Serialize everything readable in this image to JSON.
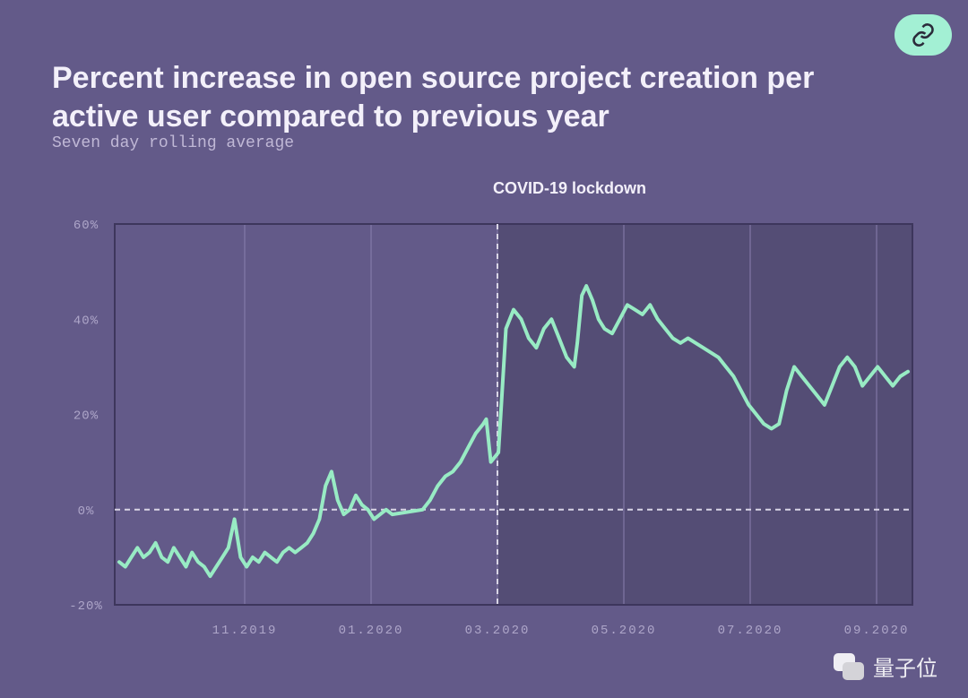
{
  "title": "Percent increase in open source project creation per active user compared to previous year",
  "subtitle": "Seven day rolling average",
  "annotation": "COVID-19 lockdown",
  "watermark": "量子位",
  "chart_data": {
    "type": "line",
    "xlabel": "",
    "ylabel": "",
    "ylim": [
      -20,
      60
    ],
    "y_ticks": [
      -20,
      0,
      20,
      40,
      60
    ],
    "y_tick_labels": [
      "-20%",
      "0%",
      "20%",
      "40%",
      "60%"
    ],
    "x_tick_labels": [
      "11.2019",
      "01.2020",
      "03.2020",
      "05.2020",
      "07.2020",
      "09.2020"
    ],
    "annotation_x": "03.2020",
    "shaded_from_x": "03.2020",
    "series": [
      {
        "name": "percent_increase",
        "x_approx_month_fraction": [
          0.0,
          0.04,
          0.08,
          0.12,
          0.16,
          0.2,
          0.24,
          0.28,
          0.32,
          0.36,
          0.4,
          0.44,
          0.48,
          0.52,
          0.56,
          0.6,
          0.64,
          0.68,
          0.72,
          0.76,
          0.8,
          0.84,
          0.88,
          0.92,
          0.96,
          1.0,
          1.04,
          1.08,
          1.12,
          1.16,
          1.2,
          1.24,
          1.28,
          1.32,
          1.36,
          1.4,
          1.44,
          1.48,
          1.52,
          1.56,
          1.6,
          1.64,
          1.68,
          1.72,
          1.76,
          1.8,
          2.0,
          2.05,
          2.1,
          2.15,
          2.2,
          2.25,
          2.3,
          2.35,
          2.4,
          2.42,
          2.45,
          2.5,
          2.55,
          2.6,
          2.65,
          2.7,
          2.75,
          2.8,
          2.85,
          2.9,
          2.95,
          3.0,
          3.02,
          3.05,
          3.08,
          3.12,
          3.16,
          3.2,
          3.25,
          3.3,
          3.35,
          3.4,
          3.45,
          3.5,
          3.55,
          3.6,
          3.65,
          3.7,
          3.75,
          3.8,
          3.85,
          3.9,
          3.95,
          4.0,
          4.05,
          4.1,
          4.15,
          4.2,
          4.25,
          4.3,
          4.35,
          4.4,
          4.45,
          4.5,
          4.55,
          4.6,
          4.65,
          4.7,
          4.75,
          4.8,
          4.85,
          4.9,
          4.95,
          5.0,
          5.05,
          5.1,
          5.15,
          5.2
        ],
        "values": [
          -11,
          -12,
          -10,
          -8,
          -10,
          -9,
          -7,
          -10,
          -11,
          -8,
          -10,
          -12,
          -9,
          -11,
          -12,
          -14,
          -12,
          -10,
          -8,
          -2,
          -10,
          -12,
          -10,
          -11,
          -9,
          -10,
          -11,
          -9,
          -8,
          -9,
          -8,
          -7,
          -5,
          -2,
          5,
          8,
          2,
          -1,
          0,
          3,
          1,
          0,
          -2,
          -1,
          0,
          -1,
          0,
          2,
          5,
          7,
          8,
          10,
          13,
          16,
          18,
          19,
          10,
          12,
          38,
          42,
          40,
          36,
          34,
          38,
          40,
          36,
          32,
          30,
          35,
          45,
          47,
          44,
          40,
          38,
          37,
          40,
          43,
          42,
          41,
          43,
          40,
          38,
          36,
          35,
          36,
          35,
          34,
          33,
          32,
          30,
          28,
          25,
          22,
          20,
          18,
          17,
          18,
          25,
          30,
          28,
          26,
          24,
          22,
          26,
          30,
          32,
          30,
          26,
          28,
          30,
          28,
          26,
          28,
          29
        ]
      }
    ]
  }
}
